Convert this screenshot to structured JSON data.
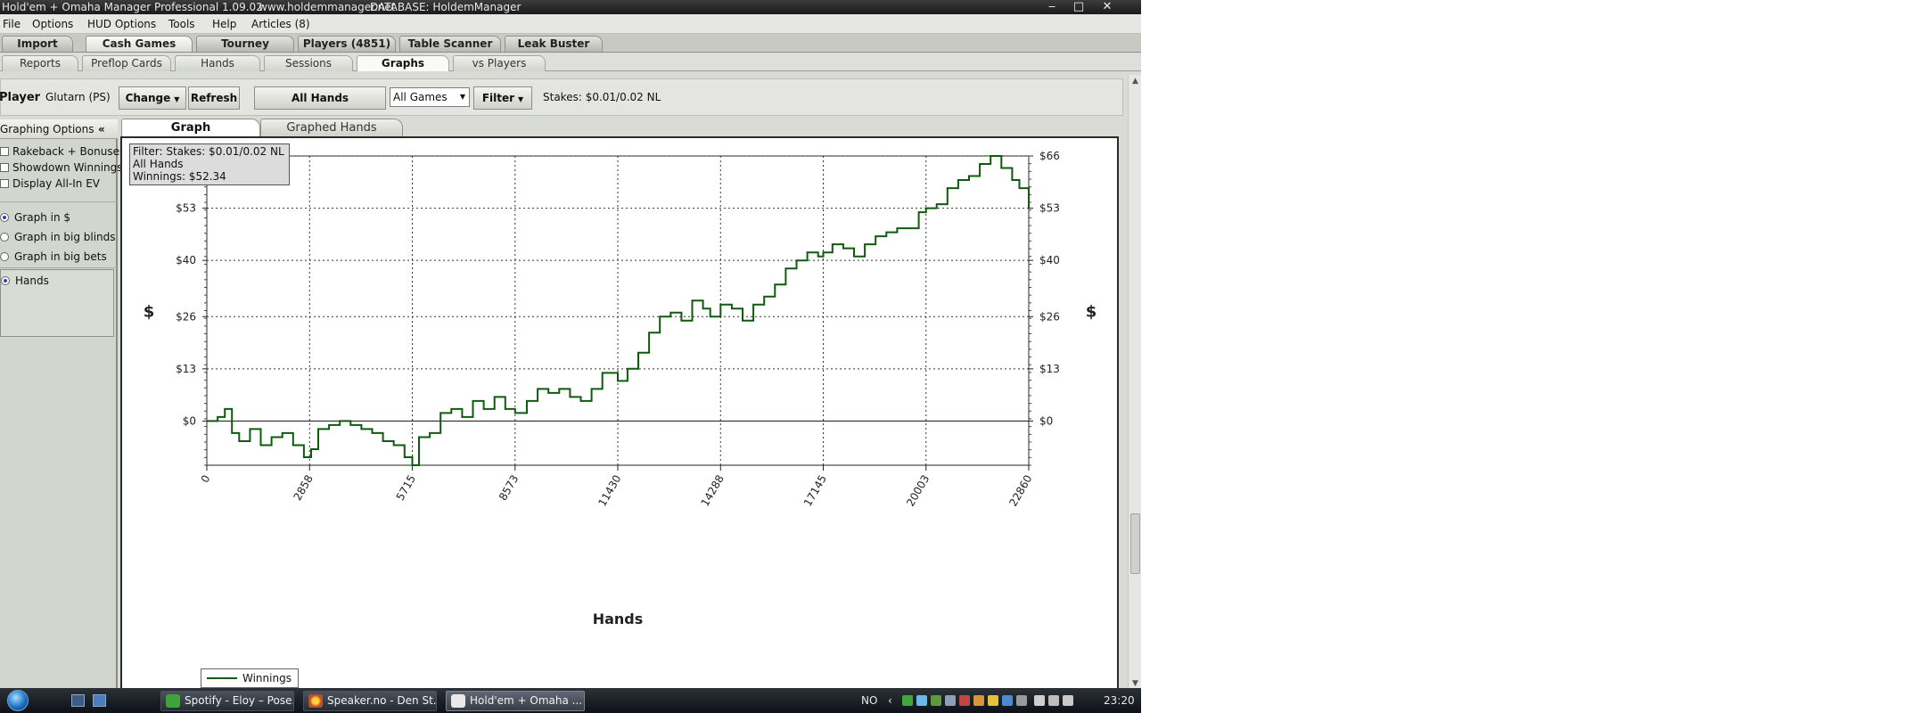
{
  "window": {
    "title": "Hold'em + Omaha Manager Professional 1.09.02",
    "website": "www.holdemmanager.net",
    "database": "DATABASE: HoldemManager"
  },
  "menu": [
    "File",
    "Options",
    "HUD Options",
    "Tools",
    "Help",
    "Articles (8)"
  ],
  "main_tabs": [
    "Import",
    "Cash Games",
    "Tourney",
    "Players (4851)",
    "Table Scanner",
    "Leak Buster"
  ],
  "sub_tabs": [
    "Reports",
    "Preflop Cards",
    "Hands",
    "Sessions",
    "Graphs",
    "vs Players"
  ],
  "toolbar": {
    "player_label": "Player",
    "player_name": "Glutarn (PS)",
    "change_label": "Change",
    "refresh_label": "Refresh",
    "all_hands_label": "All Hands",
    "games_select": "All Games",
    "filter_label": "Filter",
    "stakes_text": "Stakes: $0.01/0.02 NL"
  },
  "graphing_options": {
    "header": "Graphing Options",
    "collapse_glyph": "«",
    "checkboxes": [
      "Rakeback + Bonuses",
      "Showdown Winnings",
      "Display All-In EV"
    ],
    "radios": [
      "Graph in $",
      "Graph in big blinds",
      "Graph in big bets"
    ],
    "axis_option": "Hands"
  },
  "graph_tabs": [
    "Graph",
    "Graphed Hands"
  ],
  "info_box": {
    "filter": "Filter: Stakes: $0.01/0.02 NL",
    "hands": "All Hands",
    "winnings": "Winnings: $52.34"
  },
  "legend": {
    "series_label": "Winnings"
  },
  "colors": {
    "series": "#0e5a0e",
    "grid": "#333333"
  },
  "chart_data": {
    "type": "line",
    "title": "",
    "xlabel": "Hands",
    "ylabel": "$",
    "x_ticks": [
      0,
      2858,
      5715,
      8573,
      11430,
      14288,
      17145,
      20003,
      22860
    ],
    "y_ticks": [
      "$0",
      "$13",
      "$26",
      "$40",
      "$53",
      "$66"
    ],
    "y_tick_values": [
      0,
      13,
      26,
      40,
      53,
      66
    ],
    "xlim": [
      0,
      22860
    ],
    "ylim": [
      -11,
      66
    ],
    "grid": true,
    "legend_position": "bottom-left",
    "series": [
      {
        "name": "Winnings",
        "x": [
          0,
          300,
          500,
          700,
          900,
          1200,
          1500,
          1800,
          2100,
          2400,
          2700,
          2900,
          3100,
          3400,
          3700,
          4000,
          4300,
          4600,
          4900,
          5200,
          5500,
          5715,
          5900,
          6200,
          6500,
          6800,
          7100,
          7400,
          7700,
          8000,
          8300,
          8573,
          8900,
          9200,
          9500,
          9800,
          10100,
          10400,
          10700,
          11000,
          11430,
          11700,
          12000,
          12300,
          12600,
          12900,
          13200,
          13500,
          13800,
          14000,
          14288,
          14600,
          14900,
          15200,
          15500,
          15800,
          16100,
          16400,
          16700,
          17000,
          17145,
          17400,
          17700,
          18000,
          18300,
          18600,
          18900,
          19200,
          19500,
          19800,
          20003,
          20300,
          20600,
          20900,
          21200,
          21500,
          21800,
          22100,
          22400,
          22600,
          22860
        ],
        "y": [
          0,
          1,
          3,
          -3,
          -5,
          -2,
          -6,
          -4,
          -3,
          -6,
          -9,
          -7,
          -2,
          -1,
          0,
          -1,
          -2,
          -3,
          -5,
          -6,
          -9,
          -11,
          -4,
          -3,
          2,
          3,
          1,
          5,
          3,
          6,
          3,
          2,
          5,
          8,
          7,
          8,
          6,
          5,
          8,
          12,
          10,
          13,
          17,
          22,
          26,
          27,
          25,
          30,
          28,
          26,
          29,
          28,
          25,
          29,
          31,
          34,
          38,
          40,
          42,
          41,
          42,
          44,
          43,
          41,
          44,
          46,
          47,
          48,
          48,
          52,
          53,
          54,
          58,
          60,
          61,
          64,
          66,
          63,
          60,
          58,
          53
        ]
      }
    ]
  },
  "taskbar": {
    "tasks": [
      "Spotify - Eloy – Pose...",
      "Speaker.no - Den St...",
      "Hold'em + Omaha ..."
    ],
    "language": "NO",
    "clock": "23:20"
  }
}
